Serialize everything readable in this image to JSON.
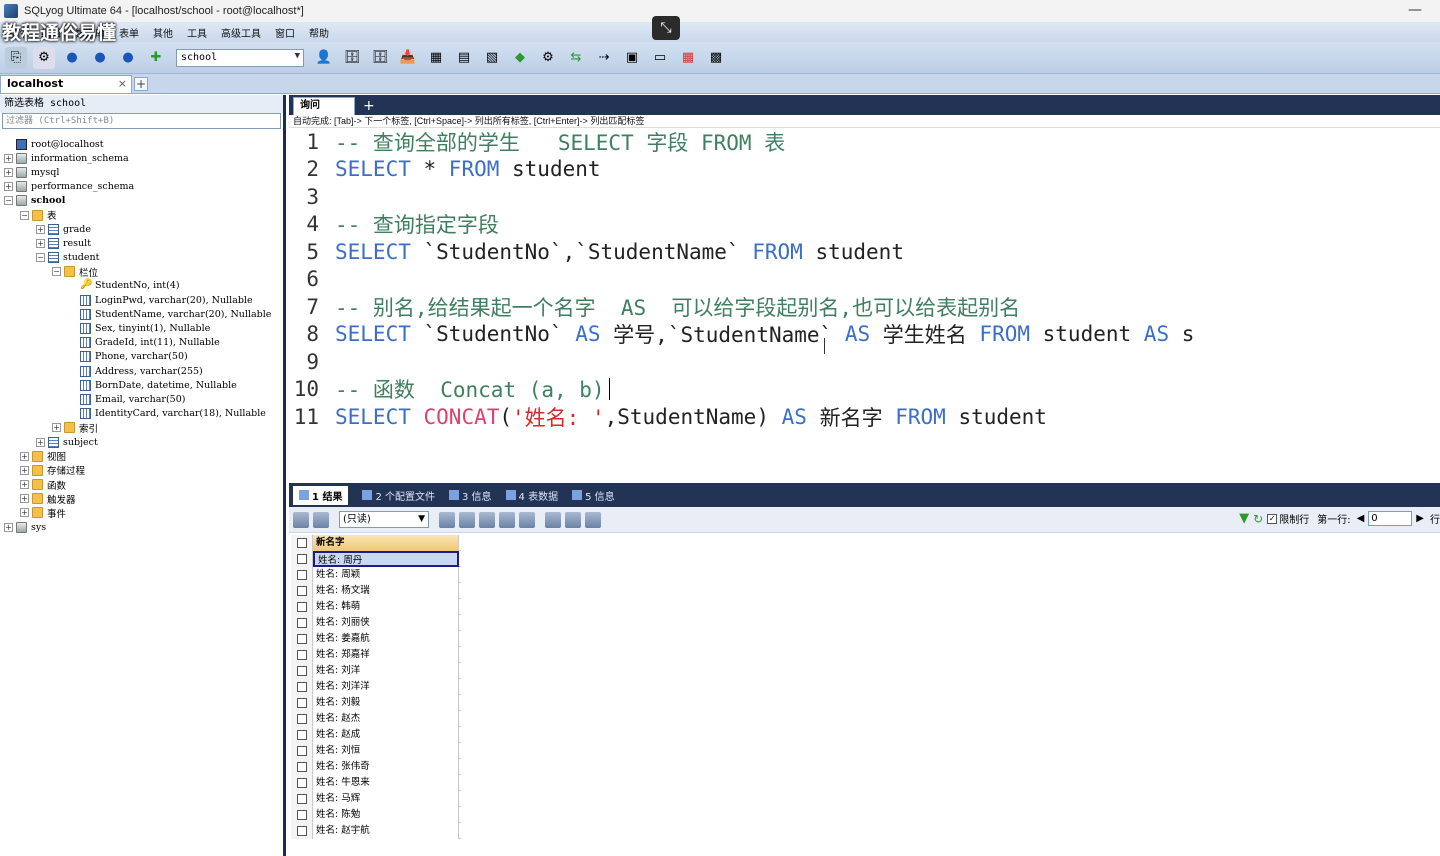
{
  "window": {
    "title": "SQLyog Ultimate 64 - [localhost/school - root@localhost*]",
    "minimize": "—"
  },
  "watermark": "教程通俗易懂",
  "menu": [
    "文件",
    "编辑",
    "数据库",
    "表单",
    "其他",
    "工具",
    "高级工具",
    "窗口",
    "帮助"
  ],
  "toolbar": {
    "db_selected": "school"
  },
  "connection": {
    "tab_label": "localhost",
    "close": "×",
    "add": "+"
  },
  "object_browser": {
    "filter_label": "筛选表格 school",
    "filter_placeholder": "过滤器 (Ctrl+Shift+B)",
    "tree": [
      {
        "label": "root@localhost",
        "level": 0,
        "icon": "server-icon",
        "exp": "",
        "bold": false
      },
      {
        "label": "information_schema",
        "level": 0,
        "icon": "database-icon",
        "exp": "+",
        "bold": false
      },
      {
        "label": "mysql",
        "level": 0,
        "icon": "database-icon",
        "exp": "+",
        "bold": false
      },
      {
        "label": "performance_schema",
        "level": 0,
        "icon": "database-icon",
        "exp": "+",
        "bold": false
      },
      {
        "label": "school",
        "level": 0,
        "icon": "database-icon",
        "exp": "−",
        "bold": true
      },
      {
        "label": "表",
        "level": 1,
        "icon": "folder-icon",
        "exp": "−",
        "bold": false
      },
      {
        "label": "grade",
        "level": 2,
        "icon": "table-icon",
        "exp": "+",
        "bold": false
      },
      {
        "label": "result",
        "level": 2,
        "icon": "table-icon",
        "exp": "+",
        "bold": false
      },
      {
        "label": "student",
        "level": 2,
        "icon": "table-icon",
        "exp": "−",
        "bold": false
      },
      {
        "label": "栏位",
        "level": 3,
        "icon": "folder-icon",
        "exp": "−",
        "bold": false
      },
      {
        "label": "StudentNo, int(4)",
        "level": 4,
        "icon": "key-icon",
        "exp": "",
        "bold": false
      },
      {
        "label": "LoginPwd, varchar(20), Nullable",
        "level": 4,
        "icon": "column-icon",
        "exp": "",
        "bold": false
      },
      {
        "label": "StudentName, varchar(20), Nullable",
        "level": 4,
        "icon": "column-icon",
        "exp": "",
        "bold": false
      },
      {
        "label": "Sex, tinyint(1), Nullable",
        "level": 4,
        "icon": "column-icon",
        "exp": "",
        "bold": false
      },
      {
        "label": "GradeId, int(11), Nullable",
        "level": 4,
        "icon": "column-icon",
        "exp": "",
        "bold": false
      },
      {
        "label": "Phone, varchar(50)",
        "level": 4,
        "icon": "column-icon",
        "exp": "",
        "bold": false
      },
      {
        "label": "Address, varchar(255)",
        "level": 4,
        "icon": "column-icon",
        "exp": "",
        "bold": false
      },
      {
        "label": "BornDate, datetime, Nullable",
        "level": 4,
        "icon": "column-icon",
        "exp": "",
        "bold": false
      },
      {
        "label": "Email, varchar(50)",
        "level": 4,
        "icon": "column-icon",
        "exp": "",
        "bold": false
      },
      {
        "label": "IdentityCard, varchar(18), Nullable",
        "level": 4,
        "icon": "column-icon",
        "exp": "",
        "bold": false
      },
      {
        "label": "索引",
        "level": 3,
        "icon": "folder-icon",
        "exp": "+",
        "bold": false
      },
      {
        "label": "subject",
        "level": 2,
        "icon": "table-icon",
        "exp": "+",
        "bold": false
      },
      {
        "label": "视图",
        "level": 1,
        "icon": "folder-icon",
        "exp": "+",
        "bold": false
      },
      {
        "label": "存储过程",
        "level": 1,
        "icon": "folder-icon",
        "exp": "+",
        "bold": false
      },
      {
        "label": "函数",
        "level": 1,
        "icon": "folder-icon",
        "exp": "+",
        "bold": false
      },
      {
        "label": "触发器",
        "level": 1,
        "icon": "folder-icon",
        "exp": "+",
        "bold": false
      },
      {
        "label": "事件",
        "level": 1,
        "icon": "folder-icon",
        "exp": "+",
        "bold": false
      },
      {
        "label": "sys",
        "level": 0,
        "icon": "database-icon",
        "exp": "+",
        "bold": false
      }
    ]
  },
  "query": {
    "tab_label": "询问",
    "add": "+",
    "hint": "自动完成: [Tab]-> 下一个标签, [Ctrl+Space]-> 列出所有标签, [Ctrl+Enter]-> 列出匹配标签",
    "lines": [
      [
        {
          "t": "-- 查询全部的学生   SELECT 字段 FROM 表",
          "c": "cm"
        }
      ],
      [
        {
          "t": "SELECT",
          "c": "kw"
        },
        {
          "t": " * ",
          "c": "txt"
        },
        {
          "t": "FROM",
          "c": "kw"
        },
        {
          "t": " student",
          "c": "txt"
        }
      ],
      [],
      [
        {
          "t": "-- 查询指定字段",
          "c": "cm"
        }
      ],
      [
        {
          "t": "SELECT",
          "c": "kw"
        },
        {
          "t": " `StudentNo`,`StudentName` ",
          "c": "txt"
        },
        {
          "t": "FROM",
          "c": "kw"
        },
        {
          "t": " student",
          "c": "txt"
        }
      ],
      [],
      [
        {
          "t": "-- 别名,给结果起一个名字  AS  可以给字段起别名,也可以给表起别名",
          "c": "cm"
        }
      ],
      [
        {
          "t": "SELECT",
          "c": "kw"
        },
        {
          "t": " `StudentNo` ",
          "c": "txt"
        },
        {
          "t": "AS",
          "c": "kw"
        },
        {
          "t": " 学号,`StudentName` ",
          "c": "txt"
        },
        {
          "t": "AS",
          "c": "kw"
        },
        {
          "t": " 学生姓名 ",
          "c": "txt"
        },
        {
          "t": "FROM",
          "c": "kw"
        },
        {
          "t": " student ",
          "c": "txt"
        },
        {
          "t": "AS",
          "c": "kw"
        },
        {
          "t": " s",
          "c": "txt"
        }
      ],
      [],
      [
        {
          "t": "-- 函数  Concat (a, b)",
          "c": "cm"
        }
      ],
      [
        {
          "t": "SELECT",
          "c": "kw"
        },
        {
          "t": " ",
          "c": "txt"
        },
        {
          "t": "CONCAT",
          "c": "fn"
        },
        {
          "t": "(",
          "c": "txt"
        },
        {
          "t": "'姓名: '",
          "c": "str"
        },
        {
          "t": ",StudentName) ",
          "c": "txt"
        },
        {
          "t": "AS",
          "c": "kw"
        },
        {
          "t": " 新名字 ",
          "c": "txt"
        },
        {
          "t": "FROM",
          "c": "kw"
        },
        {
          "t": " student",
          "c": "txt"
        }
      ]
    ],
    "cursor_line": 10
  },
  "results": {
    "tabs": [
      {
        "label": "1 结果",
        "active": true
      },
      {
        "label": "2 个配置文件",
        "active": false
      },
      {
        "label": "3 信息",
        "active": false
      },
      {
        "label": "4 表数据",
        "active": false
      },
      {
        "label": "5 信息",
        "active": false
      }
    ],
    "mode": "(只读)",
    "limit_label": "限制行",
    "first_row_label": "第一行:",
    "first_row_value": "0",
    "rows_label": "行",
    "column": "新名字",
    "rows": [
      "姓名: 周丹",
      "姓名: 周颖",
      "姓名: 杨文瑞",
      "姓名: 韩萌",
      "姓名: 刘丽侠",
      "姓名: 姜嘉航",
      "姓名: 郑嘉祥",
      "姓名: 刘洋",
      "姓名: 刘洋洋",
      "姓名: 刘毅",
      "姓名: 赵杰",
      "姓名: 赵成",
      "姓名: 刘恒",
      "姓名: 张伟奇",
      "姓名: 牛恩来",
      "姓名: 马辉",
      "姓名: 陈勉",
      "姓名: 赵宇航"
    ],
    "selected_row": 0
  }
}
